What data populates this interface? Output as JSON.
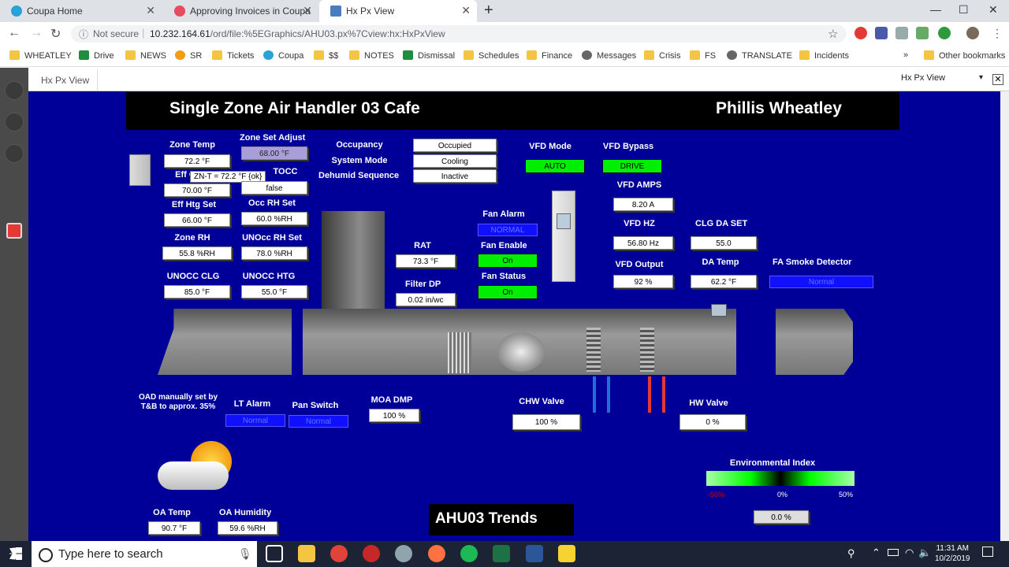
{
  "browser": {
    "tabs": [
      {
        "title": "Coupa Home"
      },
      {
        "title": "Approving Invoices in Coupa"
      },
      {
        "title": "Hx Px View"
      }
    ],
    "security_label": "Not secure",
    "url_host": "10.232.164.61",
    "url_path": "/ord/file:%5EGraphics/AHU03.px%7Cview:hx:HxPxView",
    "bookmarks": [
      "WHEATLEY",
      "Drive",
      "NEWS",
      "SR",
      "Tickets",
      "Coupa",
      "$$",
      "NOTES",
      "Dismissal",
      "Schedules",
      "Finance",
      "Messages",
      "Crisis",
      "FS",
      "TRANSLATE",
      "Incidents"
    ],
    "other_bookmarks": "Other bookmarks"
  },
  "niagara": {
    "view_tab": "Hx Px View",
    "view_select": "Hx Px View"
  },
  "ahu": {
    "title": "Single Zone Air Handler 03 Cafe",
    "site": "Phillis Wheatley",
    "zone_temp": {
      "label": "Zone Temp",
      "value": "72.2 °F"
    },
    "tooltip": "ZN-T = 72.2 °F {ok}",
    "eff_clg": {
      "label": "Eff C",
      "value": "70.00 °F"
    },
    "eff_htg": {
      "label": "Eff Htg Set",
      "value": "66.00 °F"
    },
    "zone_rh": {
      "label": "Zone RH",
      "value": "55.8 %RH"
    },
    "unocc_clg": {
      "label": "UNOCC CLG",
      "value": "85.0 °F"
    },
    "zone_set_adjust": {
      "label": "Zone Set Adjust",
      "value": "68.00 °F"
    },
    "tocc": {
      "label": "TOCC",
      "value": "false"
    },
    "occ_rh": {
      "label": "Occ RH Set",
      "value": "60.0 %RH"
    },
    "unocc_rh": {
      "label": "UNOcc RH Set",
      "value": "78.0 %RH"
    },
    "unocc_htg": {
      "label": "UNOCC HTG",
      "value": "55.0 °F"
    },
    "occupancy": {
      "label": "Occupancy",
      "value": "Occupied"
    },
    "system_mode": {
      "label": "System Mode",
      "value": "Cooling"
    },
    "dehumid": {
      "label": "Dehumid Sequence",
      "value": "Inactive"
    },
    "vfd_mode": {
      "label": "VFD Mode",
      "value": "AUTO"
    },
    "vfd_bypass": {
      "label": "VFD Bypass",
      "value": "DRIVE"
    },
    "vfd_amps": {
      "label": "VFD AMPS",
      "value": "8.20 A"
    },
    "vfd_hz": {
      "label": "VFD HZ",
      "value": "56.80 Hz"
    },
    "vfd_output": {
      "label": "VFD Output",
      "value": "92 %"
    },
    "fan_alarm": {
      "label": "Fan Alarm",
      "value": "NORMAL"
    },
    "fan_enable": {
      "label": "Fan Enable",
      "value": "On"
    },
    "fan_status": {
      "label": "Fan Status",
      "value": "On"
    },
    "rat": {
      "label": "RAT",
      "value": "73.3 °F"
    },
    "filter_dp": {
      "label": "Filter DP",
      "value": "0.02 in/wc"
    },
    "clg_da_set": {
      "label": "CLG DA SET",
      "value": "55.0"
    },
    "da_temp": {
      "label": "DA Temp",
      "value": "62.2 °F"
    },
    "fa_smoke": {
      "label": "FA Smoke Detector",
      "value": "Normal"
    },
    "oad_note": "OAD manually set by T&B to approx. 35%",
    "lt_alarm": {
      "label": "LT Alarm",
      "value": "Normal"
    },
    "pan_switch": {
      "label": "Pan Switch",
      "value": "Normal"
    },
    "moa_dmp": {
      "label": "MOA DMP",
      "value": "100 %"
    },
    "chw_valve": {
      "label": "CHW Valve",
      "value": "100 %"
    },
    "hw_valve": {
      "label": "HW Valve",
      "value": "0 %"
    },
    "env_index": {
      "label": "Environmental Index",
      "min": "-50%",
      "mid": "0%",
      "max": "50%",
      "value": "0.0 %"
    },
    "oa_temp": {
      "label": "OA Temp",
      "value": "90.7 °F"
    },
    "oa_humidity": {
      "label": "OA Humidity",
      "value": "59.6 %RH"
    },
    "trends_button": "AHU03 Trends"
  },
  "taskbar": {
    "search_placeholder": "Type here to search",
    "time": "11:31 AM",
    "date": "10/2/2019"
  }
}
